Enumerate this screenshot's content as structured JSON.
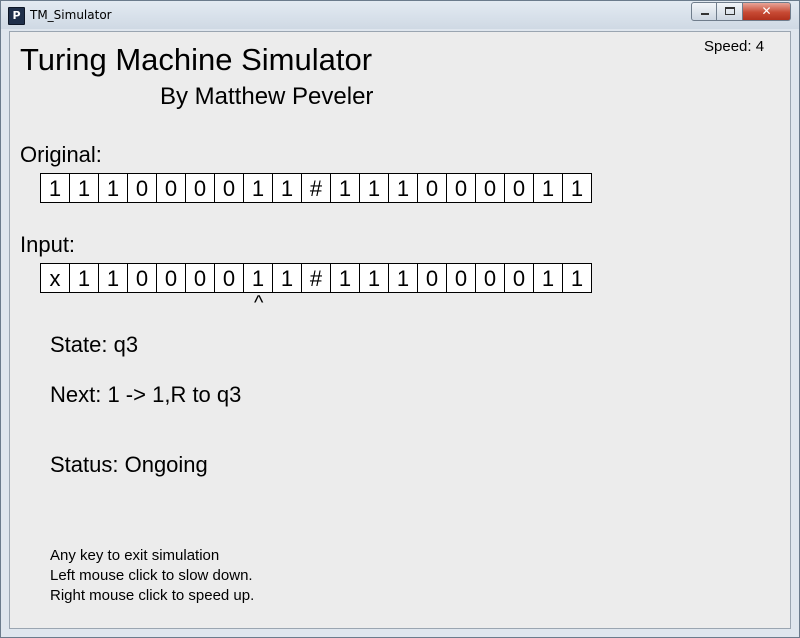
{
  "window": {
    "title": "TM_Simulator",
    "app_icon_glyph": "P",
    "close_glyph": "✕"
  },
  "header": {
    "title": "Turing Machine Simulator",
    "byline": "By Matthew Peveler",
    "speed": "Speed: 4"
  },
  "original": {
    "label": "Original:",
    "cells": [
      "1",
      "1",
      "1",
      "0",
      "0",
      "0",
      "0",
      "1",
      "1",
      "#",
      "1",
      "1",
      "1",
      "0",
      "0",
      "0",
      "0",
      "1",
      "1"
    ]
  },
  "input": {
    "label": "Input:",
    "cells": [
      "x",
      "1",
      "1",
      "0",
      "0",
      "0",
      "0",
      "1",
      "1",
      "#",
      "1",
      "1",
      "1",
      "0",
      "0",
      "0",
      "0",
      "1",
      "1"
    ],
    "head_marker": "^",
    "head_index": 7
  },
  "machine": {
    "state": "State: q3",
    "next": "Next: 1 -> 1,R to q3",
    "status": "Status:  Ongoing"
  },
  "help": {
    "line1": "Any key to exit simulation",
    "line2": "Left mouse click to slow down.",
    "line3": "Right mouse click to speed up."
  }
}
